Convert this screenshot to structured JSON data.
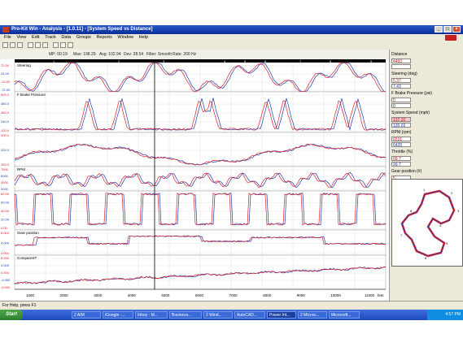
{
  "window": {
    "title": "Pro-Kit Win - Analysis - [1.0.11] - [System Speed vs Distance]",
    "controls": [
      "_",
      "□",
      "×"
    ]
  },
  "menu": [
    "File",
    "View",
    "Edit",
    "Track",
    "Data",
    "Groups",
    "Reports",
    "Window",
    "Help"
  ],
  "infobar": [
    {
      "label": "MP: 00:19"
    },
    {
      "label": "Max: 198.29"
    },
    {
      "label": "Avg: 102.94"
    },
    {
      "label": "Dev: 28.54"
    },
    {
      "label": "Filter: Smooth"
    },
    {
      "label": "Rate: 200 Hz"
    }
  ],
  "panels": [
    {
      "title": "Steering",
      "yticks": [
        "72.00",
        "24.00",
        "-24.00",
        "-72.00"
      ]
    },
    {
      "title": "F Brake Pressure",
      "yticks": [
        "600.0",
        "480.0",
        "360.0",
        "240.0",
        "120.0"
      ]
    },
    {
      "title": "",
      "yticks": [
        "300.0",
        "200.0",
        "100.0"
      ]
    },
    {
      "title": "RPM",
      "yticks": [
        "7500",
        "6000",
        "4500",
        "3000"
      ]
    },
    {
      "title": "",
      "yticks": [
        "80.00",
        "60.00",
        "40.00",
        "20.00",
        "0.00"
      ]
    },
    {
      "title": "Gear position",
      "yticks": [
        "6.000",
        "4.000",
        "2.000"
      ]
    },
    {
      "title": "CompareST",
      "yticks": [
        "8.000",
        "4.000",
        "0.000",
        "-4.000",
        "-8.000"
      ]
    }
  ],
  "segments": [
    "1",
    "2",
    "3",
    "4",
    "5",
    "6",
    "7",
    "8",
    "9"
  ],
  "xaxis": {
    "ticks": [
      "1000",
      "2000",
      "3000",
      "4000",
      "5000",
      "6000",
      "7000",
      "8000",
      "9000",
      "10000",
      "11000"
    ],
    "unit": "feet"
  },
  "right_panel": {
    "fields": [
      {
        "label": "Distance",
        "red": "4460",
        "blue": ""
      },
      {
        "label": "Steering (deg)",
        "red": "5.37",
        "blue": "7.43"
      },
      {
        "label": "F Brake Pressure (psi)",
        "red": "0",
        "blue": "0"
      },
      {
        "label": "System Speed (mph)",
        "red": "137.32",
        "blue": "135.02"
      },
      {
        "label": "RPM (rpm)",
        "red": "6531",
        "blue": "6435"
      },
      {
        "label": "Throttle (%)",
        "red": "99.7",
        "blue": "99.7"
      },
      {
        "label": "Gear position (#)",
        "red": "5",
        "blue": "5"
      },
      {
        "label": "CompareST (Sec)",
        "red": "",
        "blue": "0.590"
      }
    ],
    "trackmap_labels": [
      "1",
      "2",
      "3",
      "4",
      "5",
      "6",
      "7",
      "8"
    ]
  },
  "statusbar": {
    "text": "For Help, press F1"
  },
  "taskbar": {
    "start": "Start",
    "tasks": [
      "2 AIM",
      "iGoogle -...",
      "Inbox - M...",
      "Business...",
      "2 Wind...",
      "AutoCAD...",
      "Power Int...",
      "2 Micros...",
      "Microsoft..."
    ],
    "clock": "4:57 PM"
  },
  "colors": {
    "red_series": "#e01e2a",
    "blue_series": "#1b3fb0",
    "titlebar": "#0a2c9a"
  }
}
